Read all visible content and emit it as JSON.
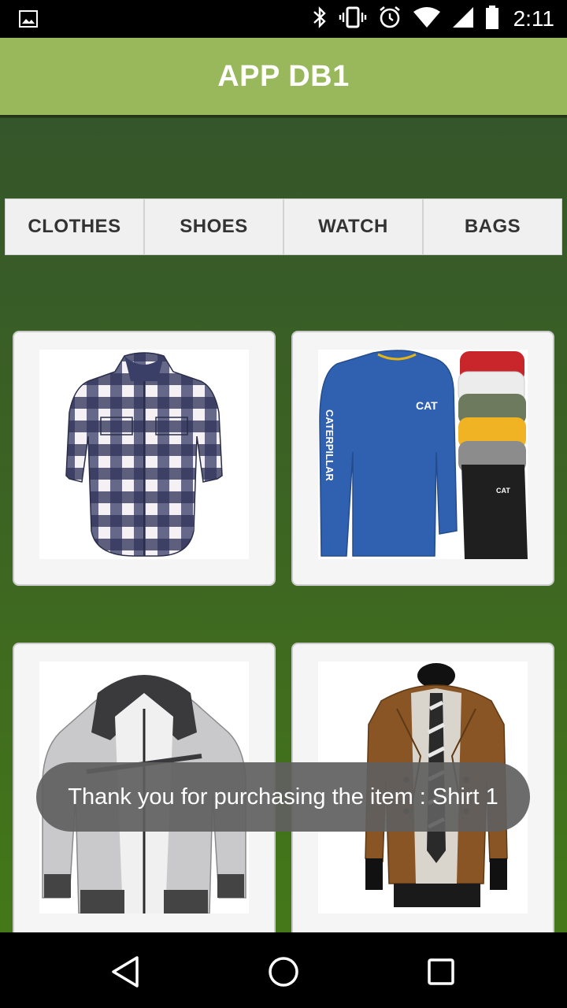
{
  "status_bar": {
    "time": "2:11",
    "icons": [
      "image-icon",
      "bluetooth-icon",
      "vibrate-icon",
      "alarm-icon",
      "wifi-icon",
      "cell-signal-icon",
      "battery-icon"
    ]
  },
  "app_bar": {
    "title": "APP DB1"
  },
  "tabs": [
    {
      "label": "CLOTHES"
    },
    {
      "label": "SHOES"
    },
    {
      "label": "WATCH"
    },
    {
      "label": "BAGS"
    }
  ],
  "products": [
    {
      "kind": "plaid-shirt-image"
    },
    {
      "kind": "cat-sweatshirt-image"
    },
    {
      "kind": "grey-hoodie-jacket-image"
    },
    {
      "kind": "brown-peacoat-image"
    }
  ],
  "toast": {
    "message": "Thank you for purchasing the item : Shirt 1"
  },
  "nav_bar": {
    "icons": [
      "back-icon",
      "home-icon",
      "recents-icon"
    ]
  },
  "colors": {
    "app_bar": "#98b85b",
    "background_top": "#35562a",
    "background_bottom": "#447819"
  }
}
